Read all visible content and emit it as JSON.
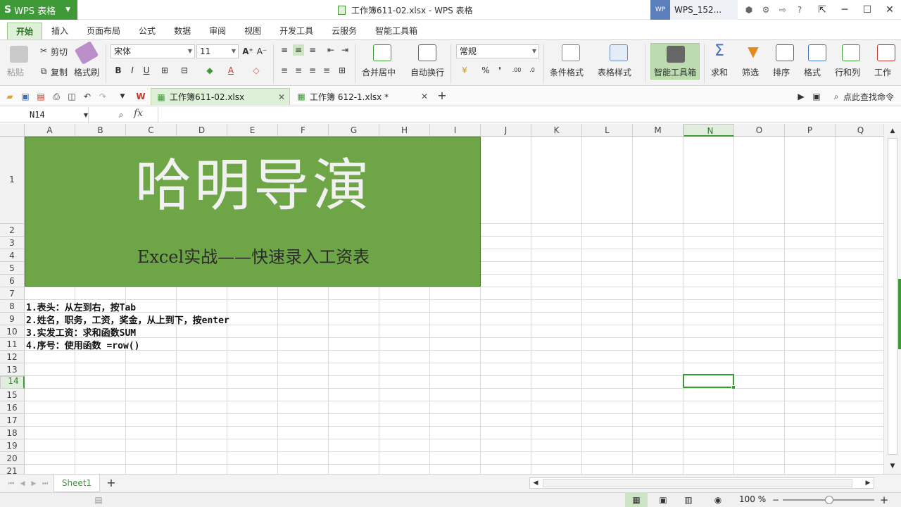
{
  "app": {
    "name": "WPS 表格",
    "logo": "S"
  },
  "window": {
    "title": "工作簿611-02.xlsx - WPS 表格",
    "user_avatar": "WP",
    "user_name": "WPS_152..."
  },
  "ribbon_tabs": [
    "开始",
    "插入",
    "页面布局",
    "公式",
    "数据",
    "审阅",
    "视图",
    "开发工具",
    "云服务",
    "智能工具箱"
  ],
  "ribbon": {
    "paste": "粘贴",
    "cut": "剪切",
    "copy": "复制",
    "format_painter": "格式刷",
    "font_name": "宋体",
    "font_size": "11",
    "merge_center": "合并居中",
    "wrap_text": "自动换行",
    "number_format": "常规",
    "percent": "%",
    "comma": "❜",
    "conditional_format": "条件格式",
    "table_style": "表格样式",
    "smart_toolbox": "智能工具箱",
    "sum": "求和",
    "filter": "筛选",
    "sort": "排序",
    "format": "格式",
    "row_col": "行和列",
    "worksheet": "工作"
  },
  "doc_tabs": [
    {
      "label": "工作簿611-02.xlsx",
      "active": true
    },
    {
      "label": "工作簿 612-1.xlsx *",
      "active": false
    }
  ],
  "search_cmd": "点此查找命令",
  "formula_bar": {
    "name_box": "N14",
    "fx": "fx",
    "content": ""
  },
  "sheet": {
    "columns": [
      "A",
      "B",
      "C",
      "D",
      "E",
      "F",
      "G",
      "H",
      "I",
      "J",
      "K",
      "L",
      "M",
      "N",
      "O",
      "P",
      "Q"
    ],
    "selected_column": "N",
    "selected_row": "14",
    "rows": [
      "1",
      "2",
      "3",
      "4",
      "5",
      "6",
      "7",
      "8",
      "9",
      "10",
      "11",
      "12",
      "13",
      "14",
      "15",
      "16",
      "17",
      "18",
      "19",
      "20",
      "21"
    ],
    "banner_title": "哈明导演",
    "banner_subtitle": "Excel实战——快速录入工资表",
    "notes": [
      "1.表头：从左到右，按Tab",
      "2.姓名，职务，工资，奖金，从上到下，按enter",
      "3.实发工资：求和函数SUM",
      "4.序号：使用函数 =row()"
    ],
    "banner_color": "#6ea647"
  },
  "sheet_tabs": [
    "Sheet1"
  ],
  "status": {
    "zoom": "100 %"
  },
  "colors": {
    "accent": "#3d9a36",
    "tab_active_bg": "#dff0d8"
  }
}
